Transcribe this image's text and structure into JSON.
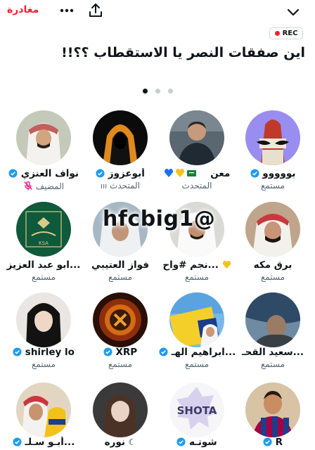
{
  "topbar": {
    "leave_label": "مغادرة"
  },
  "recording": {
    "label": "REC"
  },
  "space": {
    "title": "اين صفقات النصر يا الاستقطاب ؟؟!!"
  },
  "pager": {
    "active_index": 0,
    "count": 3
  },
  "watermark": {
    "text": "hfcbig1@"
  },
  "colors": {
    "leave": "#f4212e",
    "verified": "#1d9bf0",
    "muted": "#f91880",
    "secondary": "#536471"
  },
  "participants": [
    {
      "name": "بووووو",
      "role": "مستمع"
    },
    {
      "name": "معن",
      "role": "المتحدث"
    },
    {
      "name": "أبوعزوز",
      "role": "المتحدث"
    },
    {
      "name": "نواف العنزي",
      "role": "المضيف"
    },
    {
      "name": "برق مكه",
      "role": "مستمع"
    },
    {
      "name": "نجم #واح...",
      "role": "مستمع"
    },
    {
      "name": "فواز العتيبي",
      "role": "مستمع"
    },
    {
      "name": "ابو عبد العزيز...",
      "role": "مستمع"
    },
    {
      "name": "سعيد القحـ...",
      "role": "مستمع"
    },
    {
      "name": "ابراهيم الهـ...",
      "role": "مستمع"
    },
    {
      "name": "XRP",
      "role": "مستمع"
    },
    {
      "name": "shirley lo",
      "role": "مستمع"
    },
    {
      "name": "R",
      "role": ""
    },
    {
      "name": "شوتـه",
      "role": ""
    },
    {
      "name": "نوره",
      "role": ""
    },
    {
      "name": "أبـو سـلـ...",
      "role": ""
    }
  ],
  "avatar_text": {
    "shota": "SHOTA",
    "ksa": "KSA"
  }
}
